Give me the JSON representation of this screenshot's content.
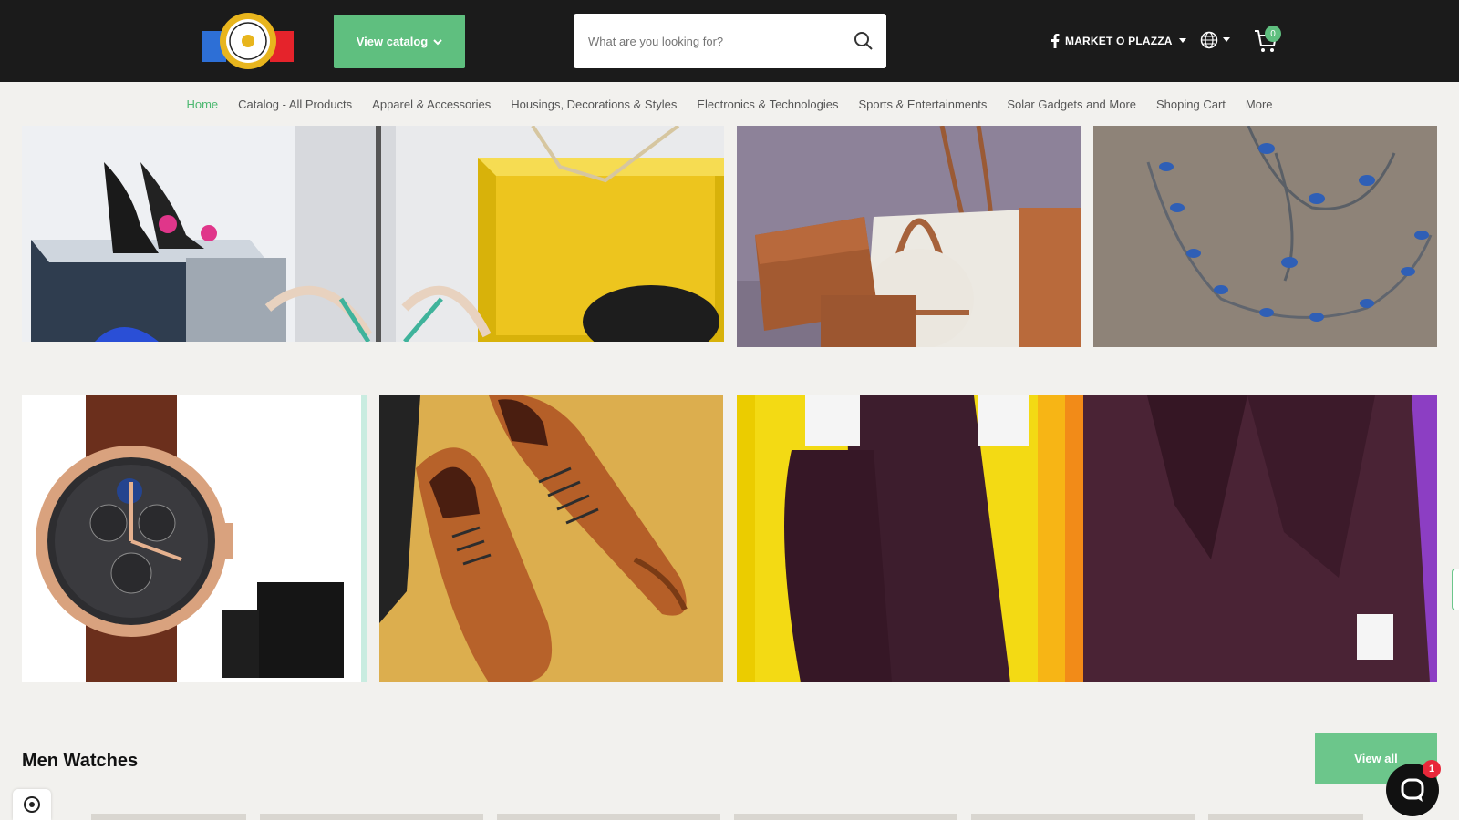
{
  "header": {
    "catalog_label": "View catalog",
    "search_placeholder": "What are you looking for?",
    "social_label": "MARKET O PLAZZA",
    "cart_count": "0"
  },
  "nav": {
    "items": [
      {
        "label": "Home",
        "active": true
      },
      {
        "label": "Catalog - All Products"
      },
      {
        "label": "Apparel & Accessories"
      },
      {
        "label": "Housings, Decorations & Styles"
      },
      {
        "label": "Electronics & Technologies"
      },
      {
        "label": "Sports & Entertainments"
      },
      {
        "label": "Solar Gadgets and More"
      },
      {
        "label": "Shoping Cart"
      },
      {
        "label": "More"
      }
    ]
  },
  "section": {
    "title": "Men Watches",
    "view_all_label": "View all"
  },
  "chat": {
    "badge": "1"
  },
  "colors": {
    "header_bg": "#1b1b1b",
    "accent": "#5fbf7f",
    "active_nav": "#4cb870",
    "page_bg": "#f2f1ee",
    "badge": "#e8283a"
  },
  "icons": [
    "logo",
    "chevron-down-icon",
    "search-icon",
    "facebook-icon",
    "globe-icon",
    "cart-icon",
    "chat-icon",
    "privacy-icon"
  ]
}
